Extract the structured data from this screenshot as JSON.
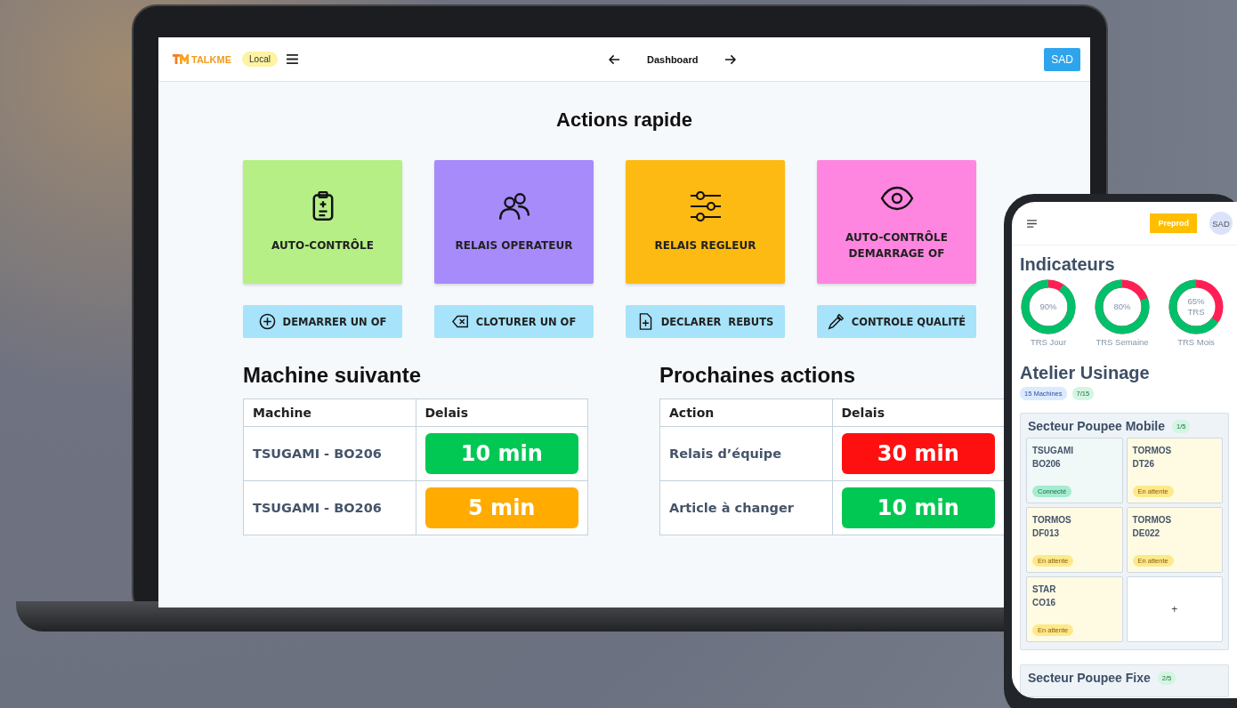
{
  "laptop": {
    "header": {
      "logo": "TALKME",
      "env_badge": "Local",
      "title": "Dashboard",
      "user_button": "SAD"
    },
    "quick_actions": {
      "title": "Actions rapide",
      "tiles": [
        {
          "kind": "clipboard",
          "label": "AUTO-CONTRÔLE",
          "color": "#b5ef86"
        },
        {
          "kind": "users",
          "label": "RELAIS OPERATEUR",
          "color": "#a78bfa"
        },
        {
          "kind": "sliders",
          "label": "RELAIS REGLEUR",
          "color": "#fdba12"
        },
        {
          "kind": "eye",
          "label": "AUTO-CONTRÔLE DEMARRAGE OF",
          "color": "#ff86e0"
        }
      ],
      "buttons": [
        {
          "kind": "plus",
          "label": "DEMARRER UN OF"
        },
        {
          "kind": "close",
          "label": "CLOTURER UN OF"
        },
        {
          "kind": "file",
          "label": "DECLARER  REBUTS"
        },
        {
          "kind": "pipette",
          "label": "CONTROLE QUALITÉ"
        }
      ]
    },
    "tables": [
      {
        "title": "Machine suivante",
        "columns": [
          "Machine",
          "Delais"
        ],
        "rows": [
          {
            "name": "TSUGAMI - BO206",
            "delay": "10 min",
            "color": "#00c853"
          },
          {
            "name": "TSUGAMI - BO206",
            "delay": "5 min",
            "color": "#ffab00"
          }
        ]
      },
      {
        "title": "Prochaines actions",
        "columns": [
          "Action",
          "Delais"
        ],
        "rows": [
          {
            "name": "Relais d’équipe",
            "delay": "30 min",
            "color": "#ff1010"
          },
          {
            "name": "Article à changer",
            "delay": "10 min",
            "color": "#00c853"
          }
        ]
      }
    ]
  },
  "phone": {
    "header": {
      "env_button": "Preprod",
      "avatar": "SAD"
    },
    "indicators": {
      "title": "Indicateurs",
      "gauges": [
        {
          "value": "90%",
          "label": "TRS Jour",
          "level": 0.9
        },
        {
          "value": "80%",
          "label": "TRS Semaine",
          "level": 0.8
        },
        {
          "value": "65% TRS",
          "label": "TRS Mois",
          "level": 0.65
        }
      ]
    },
    "workshop": {
      "title": "Atelier Usinage",
      "badges": [
        "15 Machines",
        "7/15"
      ],
      "sectors": [
        {
          "name": "Secteur Poupee Mobile",
          "count": "1/5",
          "machines": [
            {
              "kind": "connected",
              "brand": "TSUGAMI",
              "code": "BO206",
              "status": "Connecté"
            },
            {
              "kind": "waiting",
              "brand": "TORMOS",
              "code": "DT26",
              "status": "En attente"
            },
            {
              "kind": "waiting",
              "brand": "TORMOS",
              "code": "DF013",
              "status": "En attente"
            },
            {
              "kind": "waiting",
              "brand": "TORMOS",
              "code": "DE022",
              "status": "En attente"
            },
            {
              "kind": "waiting",
              "brand": "STAR",
              "code": "CO16",
              "status": "En attente"
            },
            {
              "kind": "add",
              "label": "+"
            }
          ]
        },
        {
          "name": "Secteur Poupee Fixe",
          "count": "2/5"
        }
      ]
    }
  }
}
